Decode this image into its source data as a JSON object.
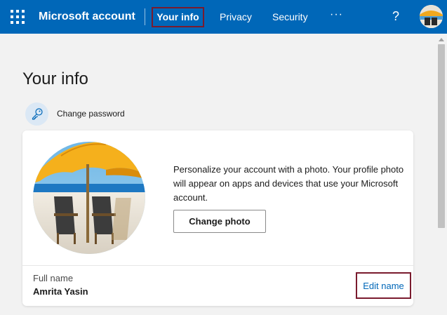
{
  "header": {
    "app_title": "Microsoft account",
    "nav": {
      "your_info": "Your info",
      "privacy": "Privacy",
      "security": "Security",
      "more": "···"
    },
    "help_label": "?",
    "icons": {
      "apps": "waffle-icon",
      "help": "help-icon",
      "profile": "avatar"
    },
    "colors": {
      "brand_bar": "#0067b8",
      "highlight_border": "#7a1b2e"
    }
  },
  "main": {
    "page_title": "Your info",
    "change_password": "Change password",
    "photo_card": {
      "description": "Personalize your account with a photo. Your profile photo will appear on apps and devices that use your Microsoft account.",
      "change_photo_button": "Change photo"
    },
    "full_name": {
      "label": "Full name",
      "value": "Amrita Yasin",
      "edit_link": "Edit name"
    }
  }
}
